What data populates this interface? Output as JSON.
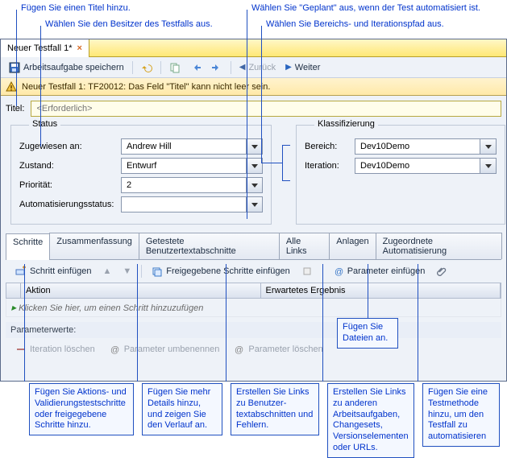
{
  "callouts": {
    "title_hint": "Fügen Sie einen Titel hinzu.",
    "owner_hint": "Wählen Sie den Besitzer des Testfalls aus.",
    "planned_hint": "Wählen Sie \"Geplant\" aus, wenn der Test automatisiert ist.",
    "area_iter_hint": "Wählen Sie Bereichs- und Iterationspfad aus.",
    "attach_hint": "Fügen Sie Dateien an.",
    "steps_hint": "Fügen Sie Aktions- und Validierungstestschritte oder freigegebene Schritte hinzu.",
    "summary_hint": "Fügen Sie mehr Details hinzu, und zeigen Sie den Verlauf an.",
    "textsections_hint": "Erstellen Sie Links zu Benutzer-textabschnitten und Fehlern.",
    "links_hint": "Erstellen Sie Links zu anderen Arbeitsaufgaben, Changesets, Versionselementen oder URLs.",
    "automation_hint": "Fügen Sie eine Testmethode hinzu, um den Testfall zu automatisieren"
  },
  "tab": {
    "title": "Neuer Testfall 1*"
  },
  "toolbar": {
    "save": "Arbeitsaufgabe speichern",
    "back": "Zurück",
    "forward": "Weiter"
  },
  "message": "Neuer Testfall 1: TF20012: Das Feld \"Titel\" kann nicht leer sein.",
  "titlefield": {
    "label": "Titel:",
    "placeholder": "<Erforderlich>"
  },
  "status": {
    "legend": "Status",
    "assigned_label": "Zugewiesen an:",
    "assigned_value": "Andrew Hill",
    "state_label": "Zustand:",
    "state_value": "Entwurf",
    "priority_label": "Priorität:",
    "priority_value": "2",
    "auto_label": "Automatisierungsstatus:",
    "auto_value": ""
  },
  "klass": {
    "legend": "Klassifizierung",
    "area_label": "Bereich:",
    "area_value": "Dev10Demo",
    "iter_label": "Iteration:",
    "iter_value": "Dev10Demo"
  },
  "tabs": {
    "t1": "Schritte",
    "t2": "Zusammenfassung",
    "t3": "Getestete Benutzertextabschnitte",
    "t4": "Alle Links",
    "t5": "Anlagen",
    "t6": "Zugeordnete Automatisierung"
  },
  "steptb": {
    "insert": "Schritt einfügen",
    "shared": "Freigegebene Schritte einfügen",
    "params": "Parameter einfügen"
  },
  "grid": {
    "col1": "Aktion",
    "col2": "Erwartetes Ergebnis",
    "placeholder": "Klicken Sie hier, um einen Schritt hinzuzufügen"
  },
  "params": {
    "label": "Parameterwerte:",
    "del_iter": "Iteration löschen",
    "rename": "Parameter umbenennen",
    "del_param": "Parameter löschen"
  }
}
